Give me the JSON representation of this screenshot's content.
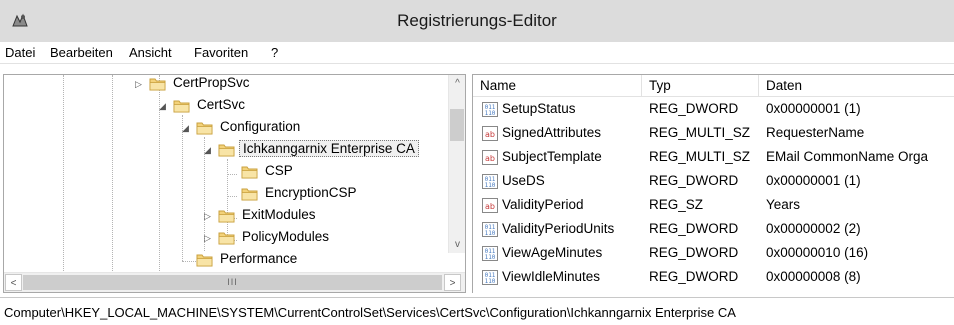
{
  "window": {
    "title": "Registrierungs-Editor"
  },
  "menu": [
    "Datei",
    "Bearbeiten",
    "Ansicht",
    "Favoriten",
    "?"
  ],
  "tree": [
    {
      "label": "CertPropSvc",
      "expander": "▷"
    },
    {
      "label": "CertSvc",
      "expander": "◢"
    },
    {
      "label": "Configuration",
      "expander": "◢"
    },
    {
      "label": "Ichkanngarnix Enterprise CA",
      "expander": "◢",
      "selected": true
    },
    {
      "label": "CSP",
      "expander": ""
    },
    {
      "label": "EncryptionCSP",
      "expander": ""
    },
    {
      "label": "ExitModules",
      "expander": "▷"
    },
    {
      "label": "PolicyModules",
      "expander": "▷"
    },
    {
      "label": "Performance",
      "expander": ""
    }
  ],
  "scroll": {
    "up": "^",
    "down": "v",
    "left": "<",
    "right": ">",
    "grip": "III"
  },
  "columns": [
    "Name",
    "Typ",
    "Daten"
  ],
  "values": [
    {
      "icon": "binary",
      "name": "SetupStatus",
      "type": "REG_DWORD",
      "data": "0x00000001 (1)"
    },
    {
      "icon": "string",
      "name": "SignedAttributes",
      "type": "REG_MULTI_SZ",
      "data": "RequesterName"
    },
    {
      "icon": "string",
      "name": "SubjectTemplate",
      "type": "REG_MULTI_SZ",
      "data": "EMail CommonName Orga"
    },
    {
      "icon": "binary",
      "name": "UseDS",
      "type": "REG_DWORD",
      "data": "0x00000001 (1)"
    },
    {
      "icon": "string",
      "name": "ValidityPeriod",
      "type": "REG_SZ",
      "data": "Years"
    },
    {
      "icon": "binary",
      "name": "ValidityPeriodUnits",
      "type": "REG_DWORD",
      "data": "0x00000002 (2)"
    },
    {
      "icon": "binary",
      "name": "ViewAgeMinutes",
      "type": "REG_DWORD",
      "data": "0x00000010 (16)"
    },
    {
      "icon": "binary",
      "name": "ViewIdleMinutes",
      "type": "REG_DWORD",
      "data": "0x00000008 (8)"
    }
  ],
  "status": {
    "path": "Computer\\HKEY_LOCAL_MACHINE\\SYSTEM\\CurrentControlSet\\Services\\CertSvc\\Configuration\\Ichkanngarnix Enterprise CA"
  },
  "colors": {
    "titlebar": "#dcdcdc",
    "folder": "#f3d27a",
    "folder_edge": "#c9a03d",
    "binary_icon": "#4a7cc0",
    "string_icon": "#c63b3b"
  }
}
